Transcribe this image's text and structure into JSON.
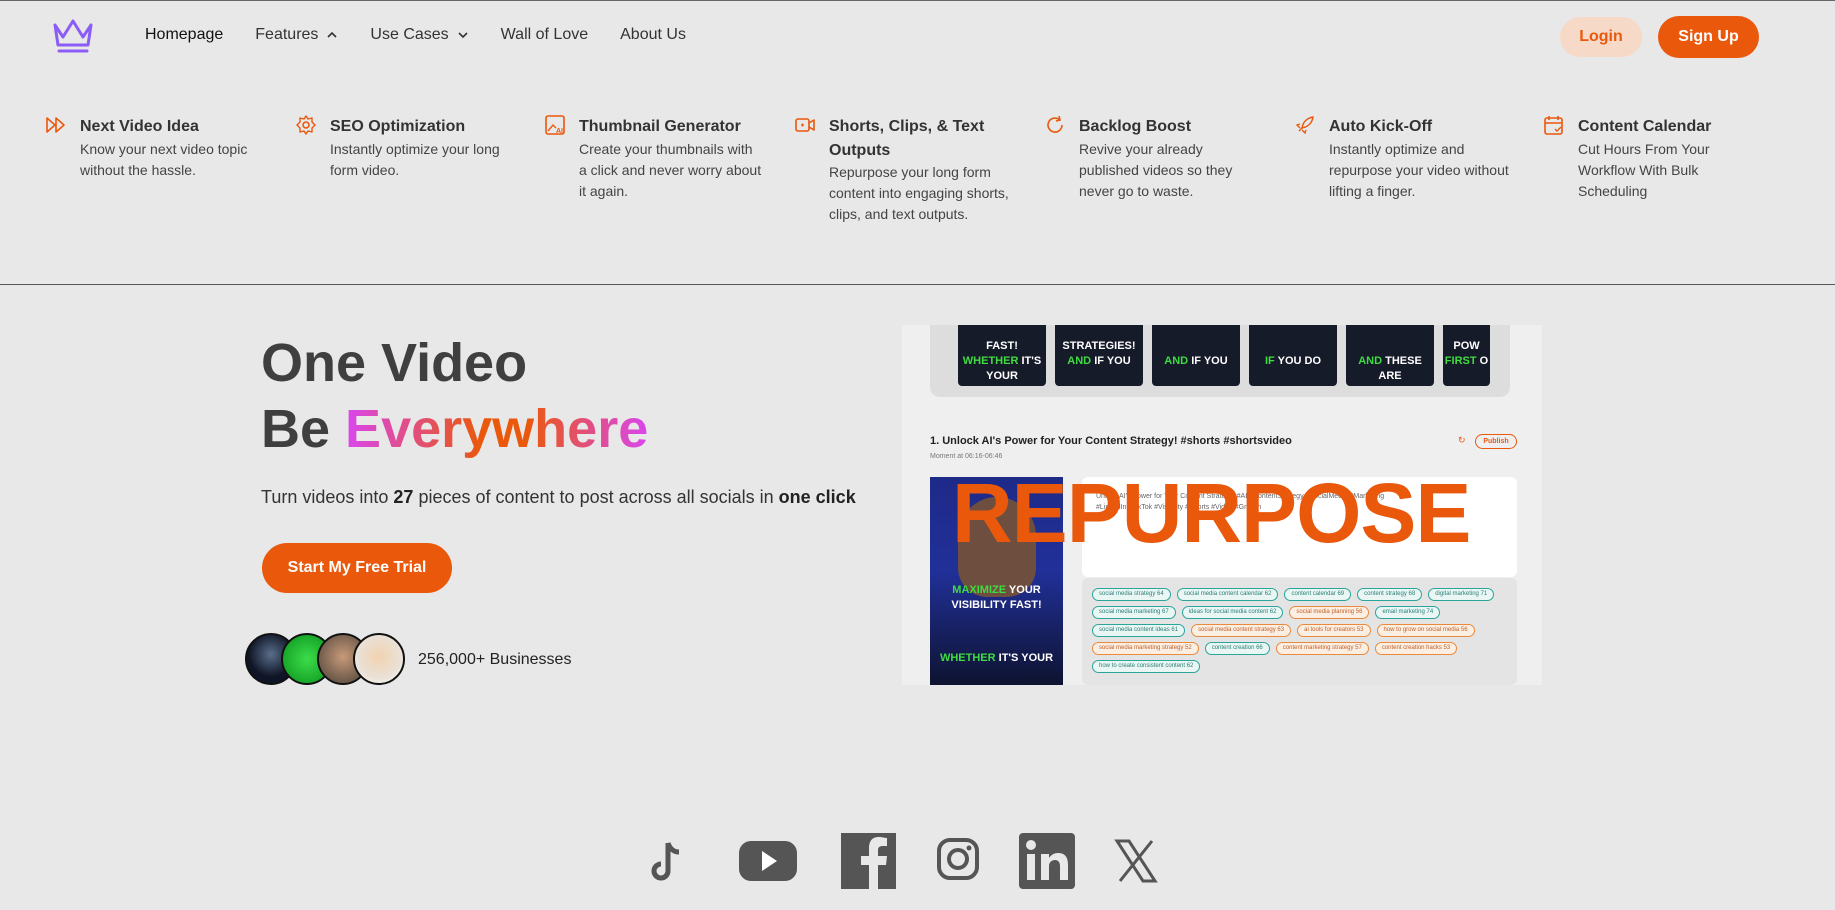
{
  "nav": {
    "links": [
      {
        "label": "Homepage"
      },
      {
        "label": "Features"
      },
      {
        "label": "Use Cases"
      },
      {
        "label": "Wall of Love"
      },
      {
        "label": "About Us"
      }
    ],
    "login_label": "Login",
    "signup_label": "Sign Up"
  },
  "features": [
    {
      "title": "Next Video Idea",
      "desc": "Know your next video topic without the hassle.",
      "icon": "fast-forward-icon"
    },
    {
      "title": "SEO Optimization",
      "desc": "Instantly optimize your long form video.",
      "icon": "gear-icon"
    },
    {
      "title": "Thumbnail Generator",
      "desc": "Create your thumbnails with a click and never worry about it again.",
      "icon": "ai-image-icon"
    },
    {
      "title": "Shorts, Clips, & Text Outputs",
      "desc": "Repurpose your long form content into engaging shorts, clips, and text outputs.",
      "icon": "video-icon"
    },
    {
      "title": "Backlog Boost",
      "desc": "Revive your already published videos so they never go to waste.",
      "icon": "refresh-icon"
    },
    {
      "title": "Auto Kick-Off",
      "desc": "Instantly optimize and repurpose your video without lifting a finger.",
      "icon": "rocket-icon"
    },
    {
      "title": "Content Calendar",
      "desc": "Cut Hours From Your Workflow With Bulk Scheduling",
      "icon": "calendar-icon"
    }
  ],
  "hero": {
    "title_line1": "One Video",
    "title_be": "Be",
    "title_highlight": "Everywhere",
    "sub_pre": "Turn videos into",
    "sub_num": "27",
    "sub_mid": "pieces of content to post across all socials in",
    "sub_bold": "one click",
    "cta_label": "Start My Free Trial",
    "businesses": "256,000+ Businesses"
  },
  "preview": {
    "thumbs": [
      {
        "top": "FAST!",
        "green": "WHETHER",
        "rest": "IT'S YOUR"
      },
      {
        "top": "STRATEGIES!",
        "green": "AND",
        "rest": "IF YOU"
      },
      {
        "top": "",
        "green": "AND",
        "rest": "IF YOU"
      },
      {
        "top": "",
        "green": "IF",
        "rest": "YOU DO"
      },
      {
        "top": "",
        "green": "AND",
        "rest": "THESE ARE"
      },
      {
        "top": "POW",
        "green": "FIRST",
        "rest": "O"
      }
    ],
    "clip_title": "1. Unlock AI's Power for Your Content Strategy! #shorts #shortsvideo",
    "clip_sub": "Moment at 06:16-06:46",
    "publish_label": "Publish",
    "overlay_word": "REPURPOSE",
    "video_line1_green": "MAXIMIZE",
    "video_line1_rest": "YOUR VISIBILITY FAST!",
    "video_line2_green": "WHETHER",
    "video_line2_rest": "IT'S YOUR",
    "textbox_text": "Unlock AI's Power for Your Content Strategy! #AI #ContentStrategy #SocialMedia #Marketing #LinkedIn #TikTok #Visibility #Shorts #Video #Growth",
    "tags": [
      {
        "t": "social media strategy  64",
        "o": false
      },
      {
        "t": "social media content calendar  62",
        "o": false
      },
      {
        "t": "content calendar  69",
        "o": false
      },
      {
        "t": "content strategy  68",
        "o": false
      },
      {
        "t": "digital marketing  71",
        "o": false
      },
      {
        "t": "social media marketing  67",
        "o": false
      },
      {
        "t": "ideas for social media content  62",
        "o": false
      },
      {
        "t": "social media planning  56",
        "o": true
      },
      {
        "t": "email marketing  74",
        "o": false
      },
      {
        "t": "social media content ideas  61",
        "o": false
      },
      {
        "t": "social media content strategy  63",
        "o": true
      },
      {
        "t": "ai tools for creators  53",
        "o": true
      },
      {
        "t": "how to grow on social media  56",
        "o": true
      },
      {
        "t": "social media marketing strategy  52",
        "o": true
      },
      {
        "t": "content creation  66",
        "o": false
      },
      {
        "t": "content marketing strategy  57",
        "o": true
      },
      {
        "t": "content creation hacks  53",
        "o": true
      },
      {
        "t": "how to create consistent content  62",
        "o": false
      }
    ]
  },
  "social": [
    "tiktok-icon",
    "youtube-icon",
    "facebook-icon",
    "instagram-icon",
    "linkedin-icon",
    "x-icon"
  ],
  "colors": {
    "accent": "#ea580c",
    "brand_purple": "#8b5cf6",
    "background": "#e8e8e8"
  }
}
